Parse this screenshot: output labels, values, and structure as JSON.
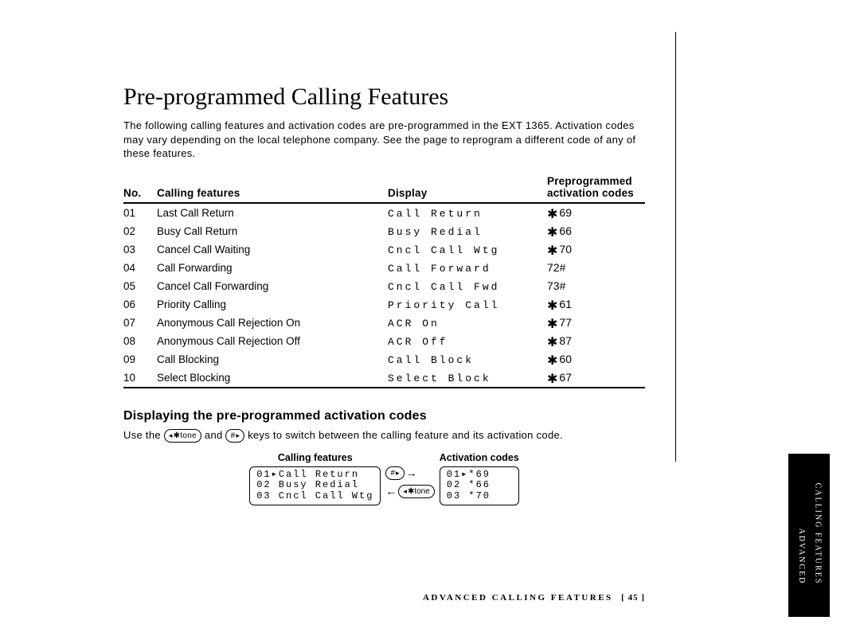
{
  "title": "Pre-programmed Calling Features",
  "intro": "The following calling features and activation codes are pre-programmed in the EXT 1365. Activation codes may vary depending on the local telephone company. See the page to reprogram a different code of any of these features.",
  "table": {
    "headers": {
      "no": "No.",
      "feature": "Calling features",
      "display": "Display",
      "code": "Preprogrammed activation codes"
    },
    "rows": [
      {
        "no": "01",
        "feature": "Last Call Return",
        "display": "Call Return",
        "code_prefix": "✱",
        "code": "69"
      },
      {
        "no": "02",
        "feature": "Busy Call Return",
        "display": "Busy Redial",
        "code_prefix": "✱",
        "code": "66"
      },
      {
        "no": "03",
        "feature": "Cancel Call Waiting",
        "display": "Cncl Call Wtg",
        "code_prefix": "✱",
        "code": "70"
      },
      {
        "no": "04",
        "feature": "Call Forwarding",
        "display": "Call Forward",
        "code_prefix": "",
        "code": "72#"
      },
      {
        "no": "05",
        "feature": "Cancel Call Forwarding",
        "display": "Cncl Call Fwd",
        "code_prefix": "",
        "code": "73#"
      },
      {
        "no": "06",
        "feature": "Priority Calling",
        "display": "Priority Call",
        "code_prefix": "✱",
        "code": "61"
      },
      {
        "no": "07",
        "feature": "Anonymous Call Rejection On",
        "display": "ACR On",
        "code_prefix": "✱",
        "code": "77"
      },
      {
        "no": "08",
        "feature": "Anonymous Call Rejection Off",
        "display": "ACR Off",
        "code_prefix": "✱",
        "code": "87"
      },
      {
        "no": "09",
        "feature": "Call Blocking",
        "display": "Call Block",
        "code_prefix": "✱",
        "code": "60"
      },
      {
        "no": "10",
        "feature": "Select Blocking",
        "display": "Select Block",
        "code_prefix": "✱",
        "code": "67"
      }
    ]
  },
  "subheading": "Displaying the pre-programmed activation codes",
  "use_prefix": "Use the",
  "key1_label": "✱tone",
  "use_mid": "and",
  "key2_label": "#",
  "use_suffix": "keys to switch between the calling feature and its activation code.",
  "diagram": {
    "left_label": "Calling features",
    "right_label": "Activation codes",
    "key_right": "#",
    "key_left": "✱tone",
    "left_lines": [
      "01▸Call Return",
      "02 Busy Redial",
      "03 Cncl Call Wtg"
    ],
    "right_lines": [
      "01▸*69",
      "02 *66",
      "03 *70"
    ]
  },
  "footer": {
    "section": "ADVANCED CALLING FEATURES",
    "page": "[ 45 ]"
  },
  "tab": {
    "line1": "ADVANCED",
    "line2": "CALLING FEATURES"
  }
}
